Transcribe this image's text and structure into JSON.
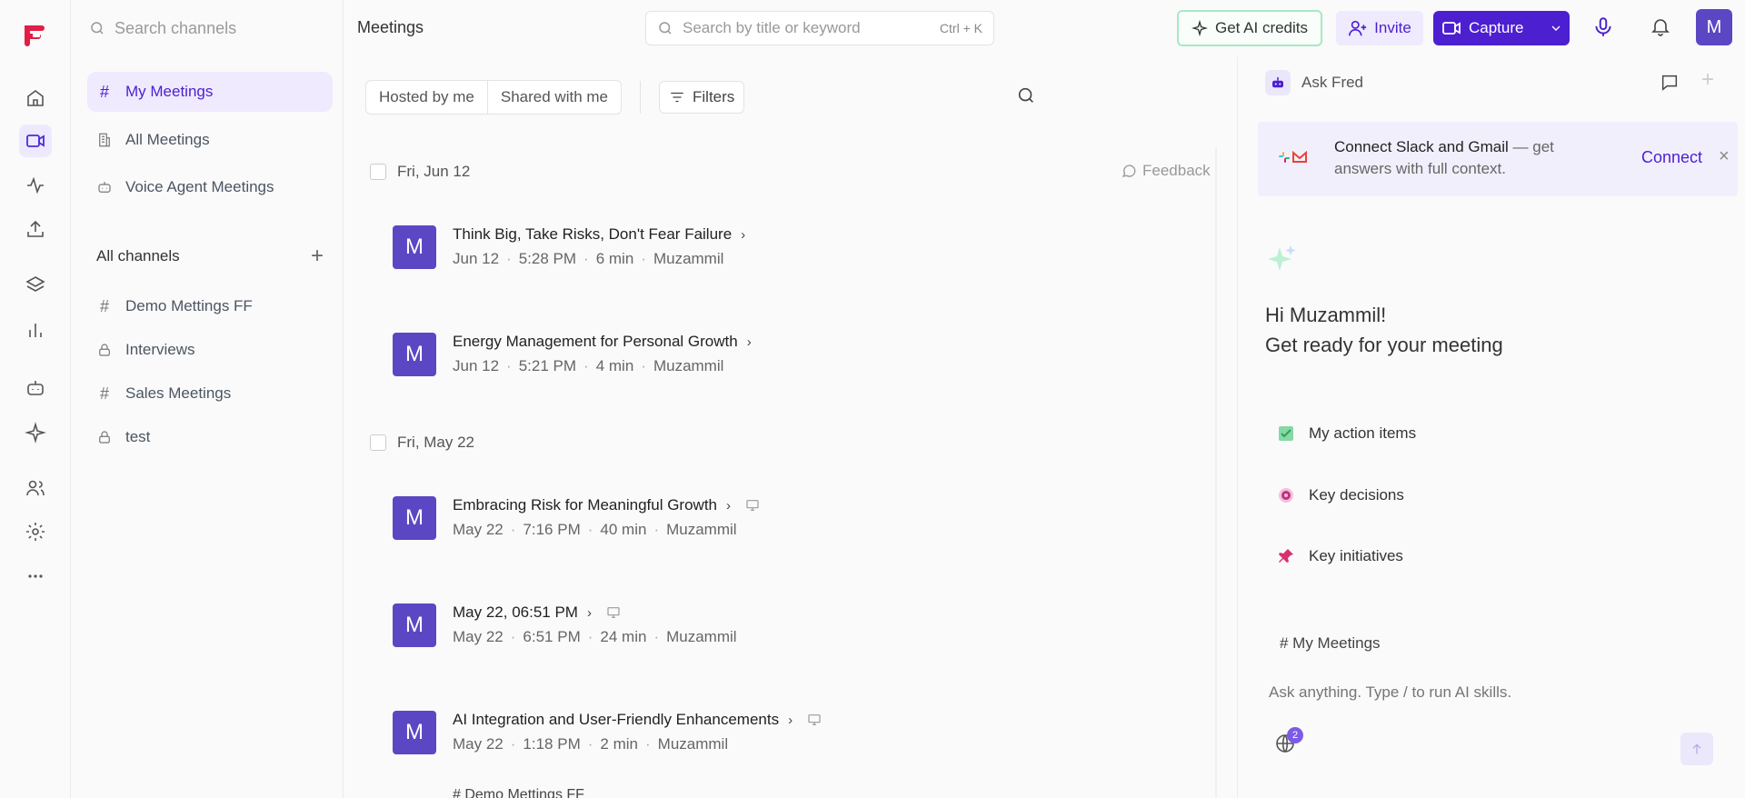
{
  "rail": {
    "items": [
      "home-icon",
      "video-icon",
      "activity-icon",
      "upload-icon",
      "layers-icon",
      "bar-chart-icon",
      "bot-icon",
      "sparkle-icon",
      "users-icon",
      "gear-icon",
      "more-icon"
    ]
  },
  "channels": {
    "search_placeholder": "Search channels",
    "top_items": [
      {
        "label": "My Meetings",
        "icon": "#"
      },
      {
        "label": "All Meetings",
        "icon": "building-icon"
      },
      {
        "label": "Voice Agent Meetings",
        "icon": "bot-icon"
      }
    ],
    "section_title": "All channels",
    "section_add": "+",
    "items": [
      {
        "label": "Demo Mettings FF",
        "icon": "#"
      },
      {
        "label": "Interviews",
        "icon": "lock-icon"
      },
      {
        "label": "Sales Meetings",
        "icon": "#"
      },
      {
        "label": "test",
        "icon": "lock-icon"
      }
    ]
  },
  "topbar": {
    "title": "Meetings",
    "search_placeholder": "Search by title or keyword",
    "search_shortcut": "Ctrl + K",
    "credits_label": "Get AI credits",
    "invite_label": "Invite",
    "capture_label": "Capture",
    "avatar_letter": "M"
  },
  "meetings": {
    "filter_hosted": "Hosted by me",
    "filter_shared": "Shared with me",
    "filters_label": "Filters",
    "feedback_label": "Feedback",
    "groups": [
      {
        "date": "Fri, Jun 12"
      },
      {
        "date": "Fri, May 22"
      }
    ],
    "list": [
      {
        "avatar": "M",
        "title": "Think Big, Take Risks, Don't Fear Failure",
        "date": "Jun 12",
        "time": "5:28 PM",
        "duration": "6 min",
        "owner": "Muzammil"
      },
      {
        "avatar": "M",
        "title": "Energy Management for Personal Growth",
        "date": "Jun 12",
        "time": "5:21 PM",
        "duration": "4 min",
        "owner": "Muzammil"
      },
      {
        "avatar": "M",
        "title": "Embracing Risk for Meaningful Growth",
        "date": "May 22",
        "time": "7:16 PM",
        "duration": "40 min",
        "owner": "Muzammil"
      },
      {
        "avatar": "M",
        "title": "May 22, 06:51 PM",
        "date": "May 22",
        "time": "6:51 PM",
        "duration": "24 min",
        "owner": "Muzammil"
      },
      {
        "avatar": "M",
        "title": "AI Integration and User-Friendly Enhancements",
        "date": "May 22",
        "time": "1:18 PM",
        "duration": "2 min",
        "owner": "Muzammil"
      }
    ],
    "partial_tag": "# Demo Mettings FF"
  },
  "fred": {
    "title": "Ask Fred",
    "connect_bold": "Connect Slack and Gmail",
    "connect_rest": " — get answers with full context.",
    "connect_link": "Connect",
    "greeting_line1": "Hi Muzammil!",
    "greeting_line2": "Get ready for your meeting",
    "prompts": [
      {
        "label": "My action items",
        "icon": "checkbox-icon"
      },
      {
        "label": "Key decisions",
        "icon": "target-icon"
      },
      {
        "label": "Key initiatives",
        "icon": "pin-icon"
      }
    ],
    "context_label": "# My Meetings",
    "input_placeholder": "Ask anything. Type / to run AI skills.",
    "globe_badge": "2"
  },
  "colors": {
    "brand": "#4c1fd1",
    "brand_light": "#efeafd",
    "avatar": "#5b47c4",
    "credits_border": "#a7e8c4"
  }
}
